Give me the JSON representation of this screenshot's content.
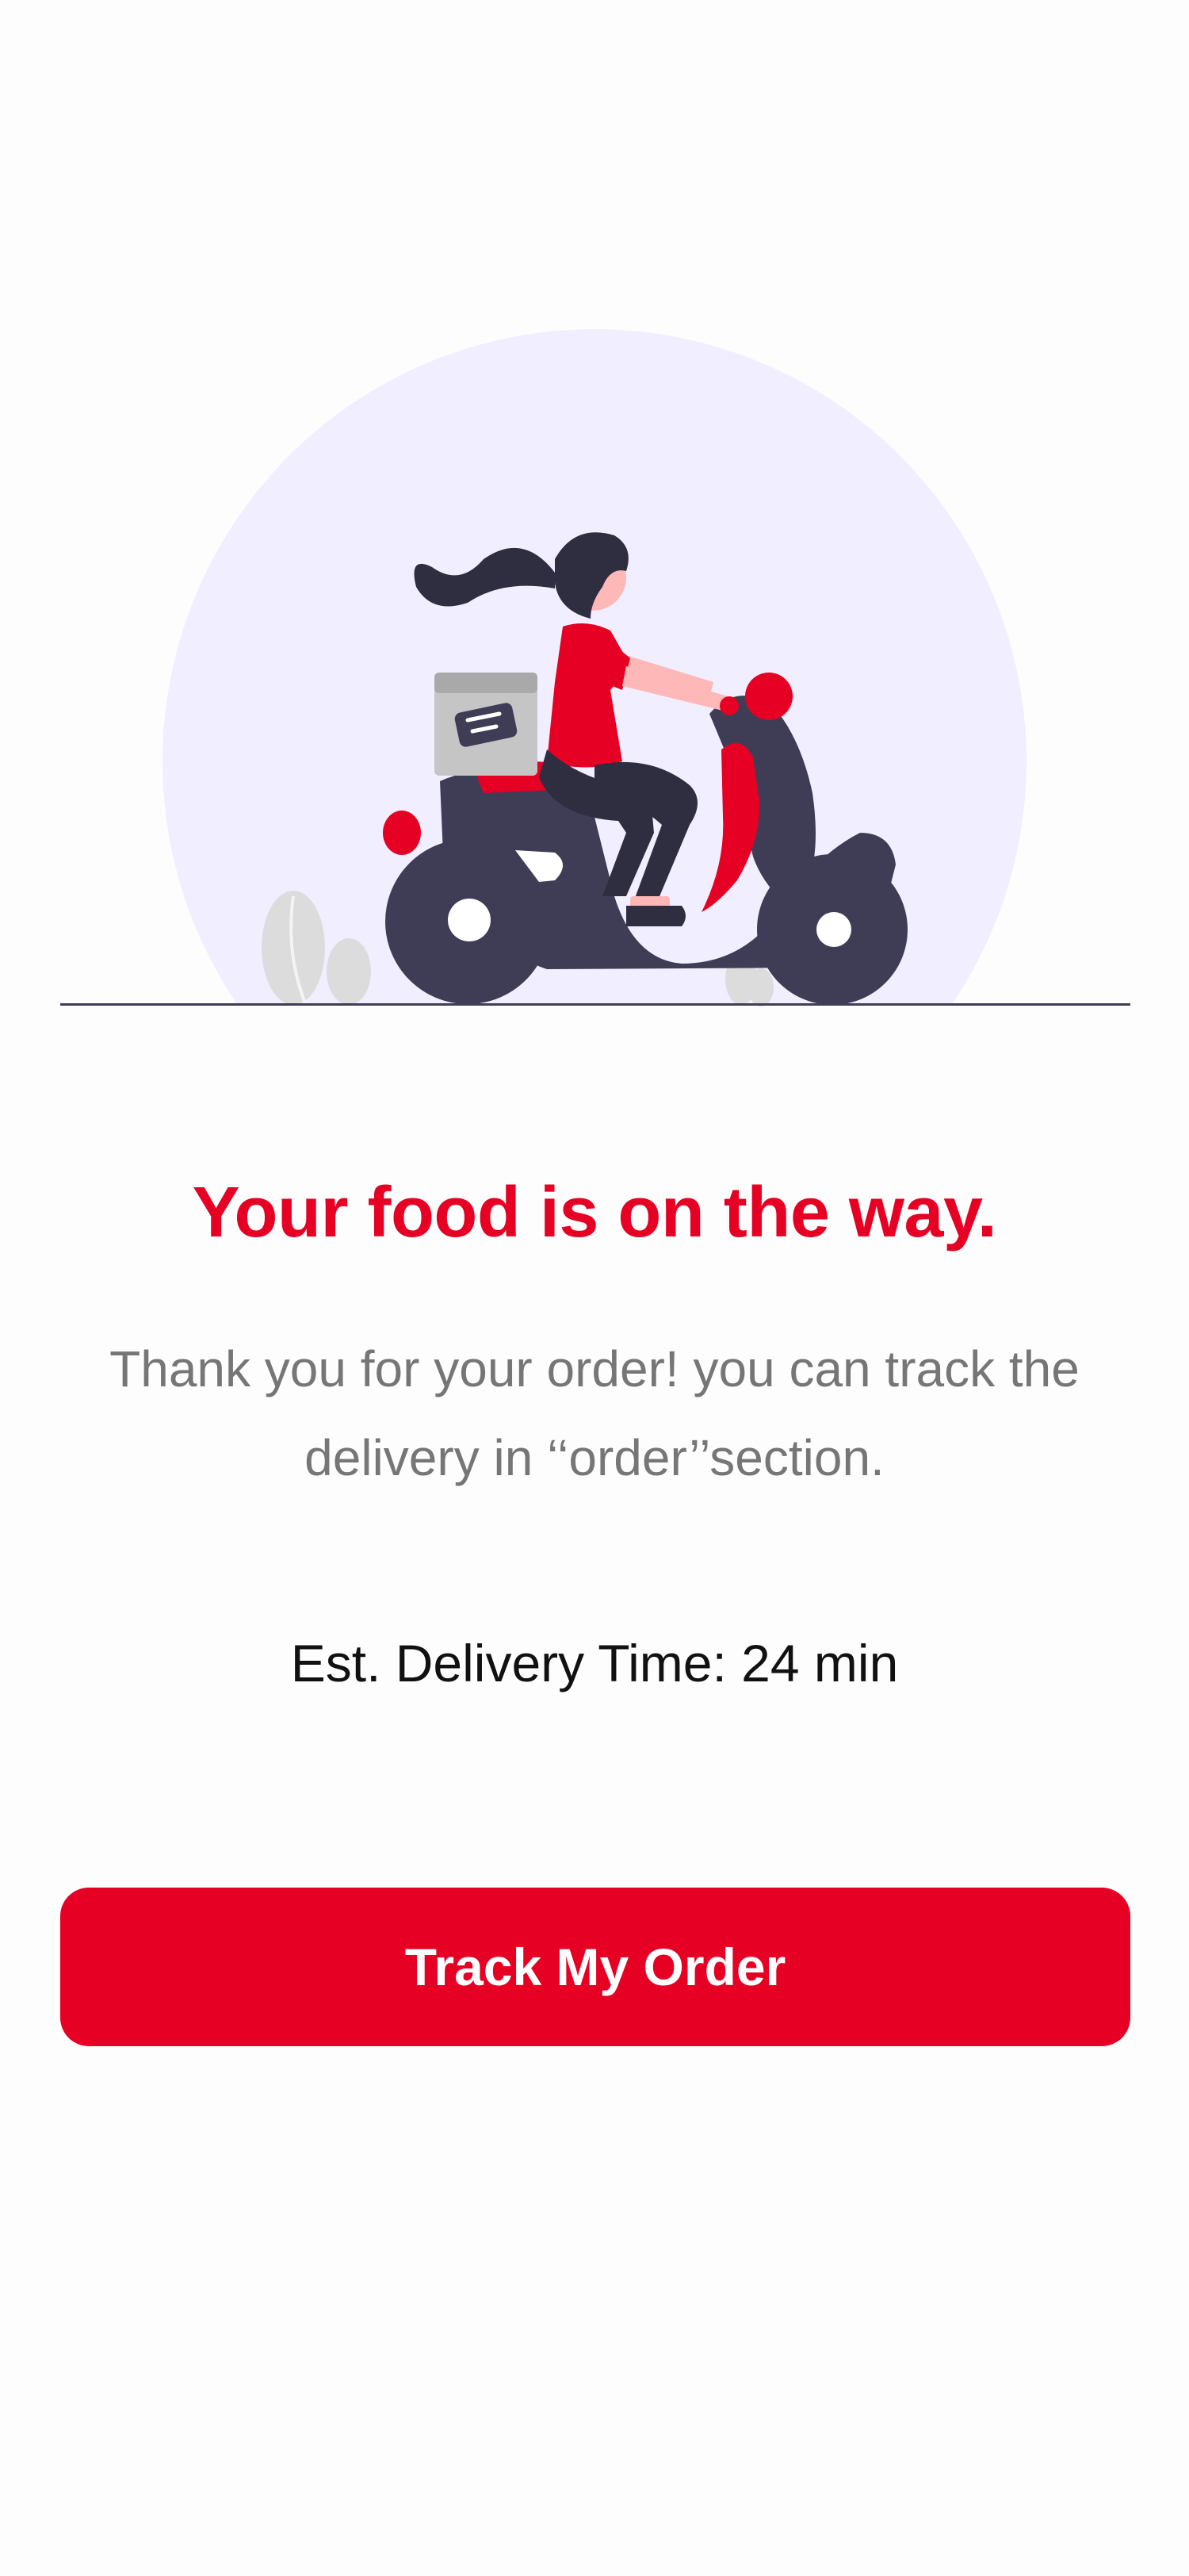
{
  "confirmation": {
    "headline": "Your food is on the way.",
    "message": "Thank you for your order! you can track the delivery in ‘‘order’’section.",
    "eta_label": "Est. Delivery Time:",
    "eta_value": "24 min"
  },
  "actions": {
    "track_label": "Track My Order"
  },
  "illustration": {
    "icon": "delivery-scooter-illustration"
  },
  "colors": {
    "accent": "#e60023",
    "background": "#fdfdfd",
    "circle": "#f1efff",
    "dark": "#3f3d56",
    "text_muted": "#767676",
    "text_dark": "#111111"
  }
}
